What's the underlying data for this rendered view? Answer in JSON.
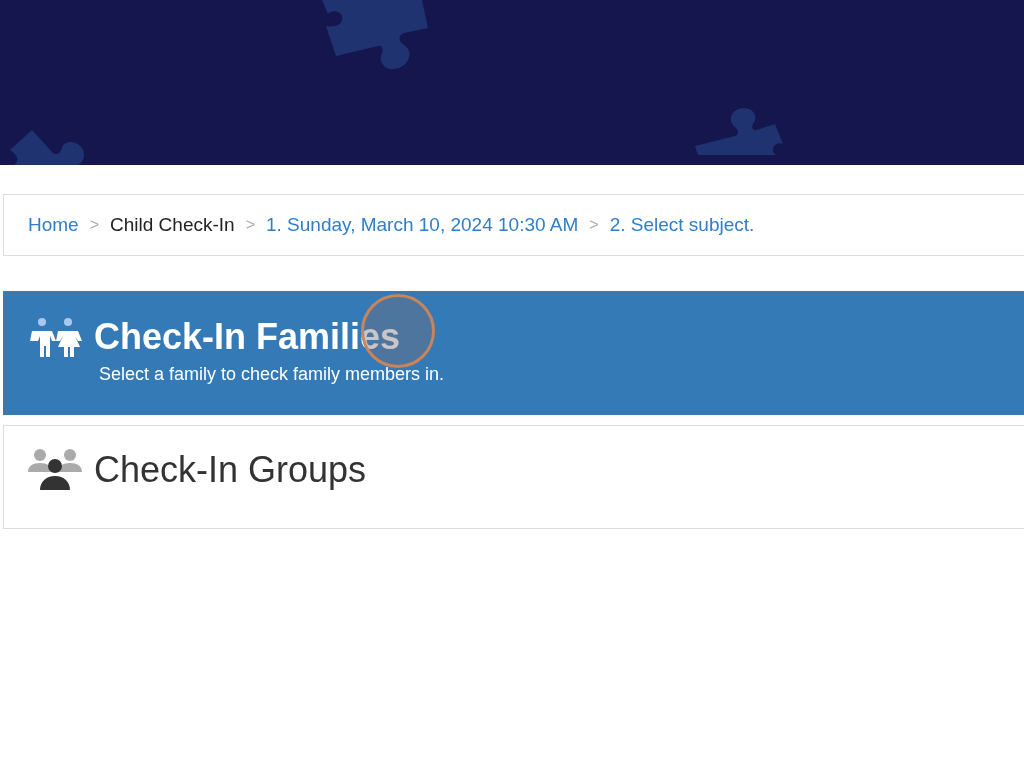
{
  "breadcrumb": [
    {
      "label": "Home",
      "kind": "link"
    },
    {
      "label": "Child Check-In",
      "kind": "current"
    },
    {
      "label": "1. Sunday, March 10, 2024 10:30 AM",
      "kind": "link"
    },
    {
      "label": "2. Select subject.",
      "kind": "link"
    }
  ],
  "breadcrumb_separator": ">",
  "options": [
    {
      "title": "Check-In Families",
      "description": "Select a family to check family members in.",
      "kind": "family",
      "selected": true
    },
    {
      "title": "Check-In Groups",
      "kind": "group",
      "selected": false
    }
  ]
}
